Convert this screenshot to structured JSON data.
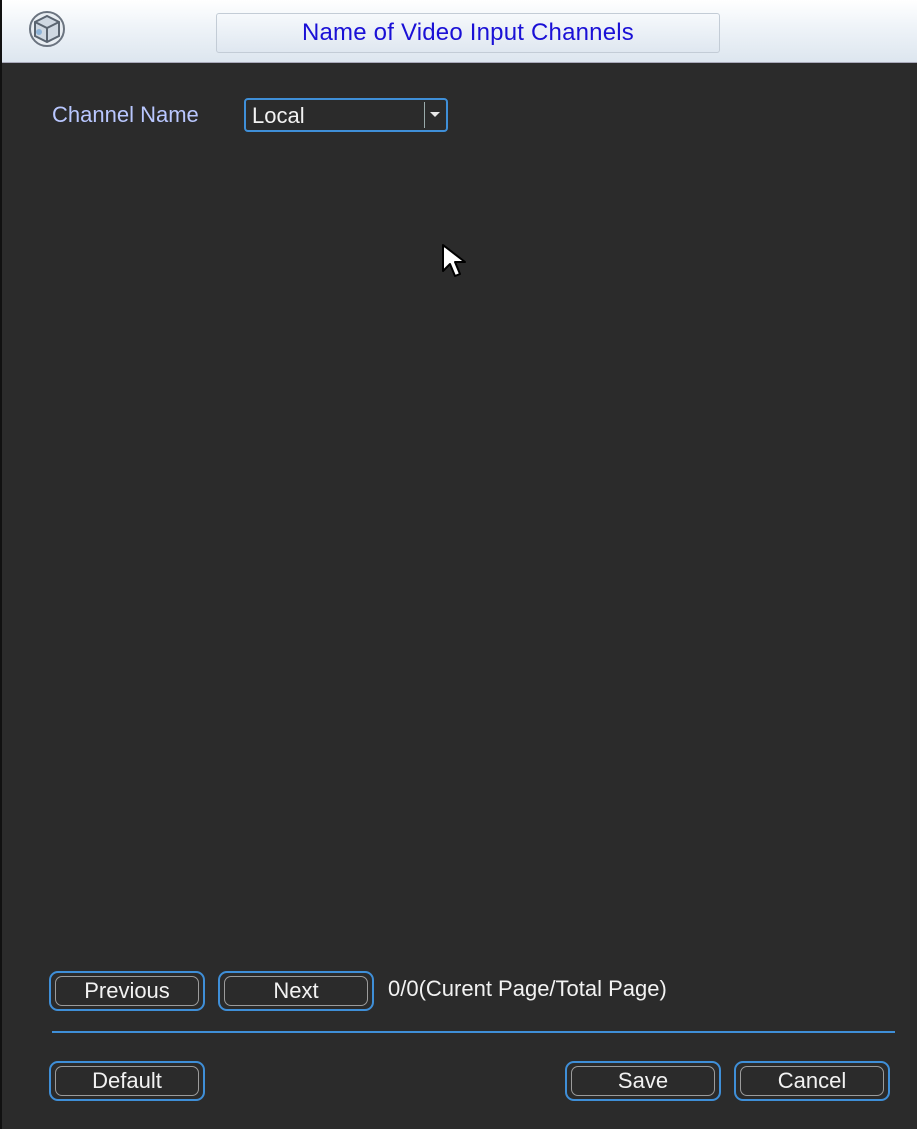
{
  "window": {
    "title": "Name of Video Input Channels"
  },
  "channel": {
    "label": "Channel Name",
    "selected": "Local"
  },
  "pager": {
    "previous_label": "Previous",
    "next_label": "Next",
    "page_info": "0/0(Curent Page/Total Page)"
  },
  "footer": {
    "default_label": "Default",
    "save_label": "Save",
    "cancel_label": "Cancel"
  },
  "icons": {
    "app": "camera-ball-icon",
    "dropdown": "chevron-down-icon",
    "cursor": "mouse-pointer-icon"
  },
  "colors": {
    "background": "#2b2b2b",
    "accent": "#3f8fd8",
    "title_text": "#1a10d6",
    "label_text": "#b9c7ff"
  }
}
